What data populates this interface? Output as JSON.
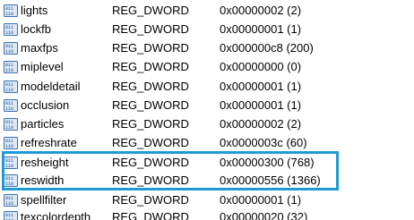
{
  "colors": {
    "highlight_box": "#1e9ad6",
    "icon_border": "#3a6fb0",
    "icon_fill": "#dbe8f7"
  },
  "entries": [
    {
      "name": "lights",
      "type": "REG_DWORD",
      "data": "0x00000002 (2)",
      "icon": "registry-binary-value-icon"
    },
    {
      "name": "lockfb",
      "type": "REG_DWORD",
      "data": "0x00000001 (1)",
      "icon": "registry-binary-value-icon"
    },
    {
      "name": "maxfps",
      "type": "REG_DWORD",
      "data": "0x000000c8 (200)",
      "icon": "registry-binary-value-icon"
    },
    {
      "name": "miplevel",
      "type": "REG_DWORD",
      "data": "0x00000000 (0)",
      "icon": "registry-binary-value-icon"
    },
    {
      "name": "modeldetail",
      "type": "REG_DWORD",
      "data": "0x00000001 (1)",
      "icon": "registry-binary-value-icon"
    },
    {
      "name": "occlusion",
      "type": "REG_DWORD",
      "data": "0x00000001 (1)",
      "icon": "registry-binary-value-icon"
    },
    {
      "name": "particles",
      "type": "REG_DWORD",
      "data": "0x00000002 (2)",
      "icon": "registry-binary-value-icon"
    },
    {
      "name": "refreshrate",
      "type": "REG_DWORD",
      "data": "0x0000003c (60)",
      "icon": "registry-binary-value-icon"
    },
    {
      "name": "resheight",
      "type": "REG_DWORD",
      "data": "0x00000300 (768)",
      "icon": "registry-binary-value-icon"
    },
    {
      "name": "reswidth",
      "type": "REG_DWORD",
      "data": "0x00000556 (1366)",
      "icon": "registry-binary-value-icon"
    },
    {
      "name": "spellfilter",
      "type": "REG_DWORD",
      "data": "0x00000001 (1)",
      "icon": "registry-binary-value-icon"
    },
    {
      "name": "texcolordepth",
      "type": "REG_DWORD",
      "data": "0x00000020 (32)",
      "icon": "registry-binary-value-icon"
    }
  ]
}
